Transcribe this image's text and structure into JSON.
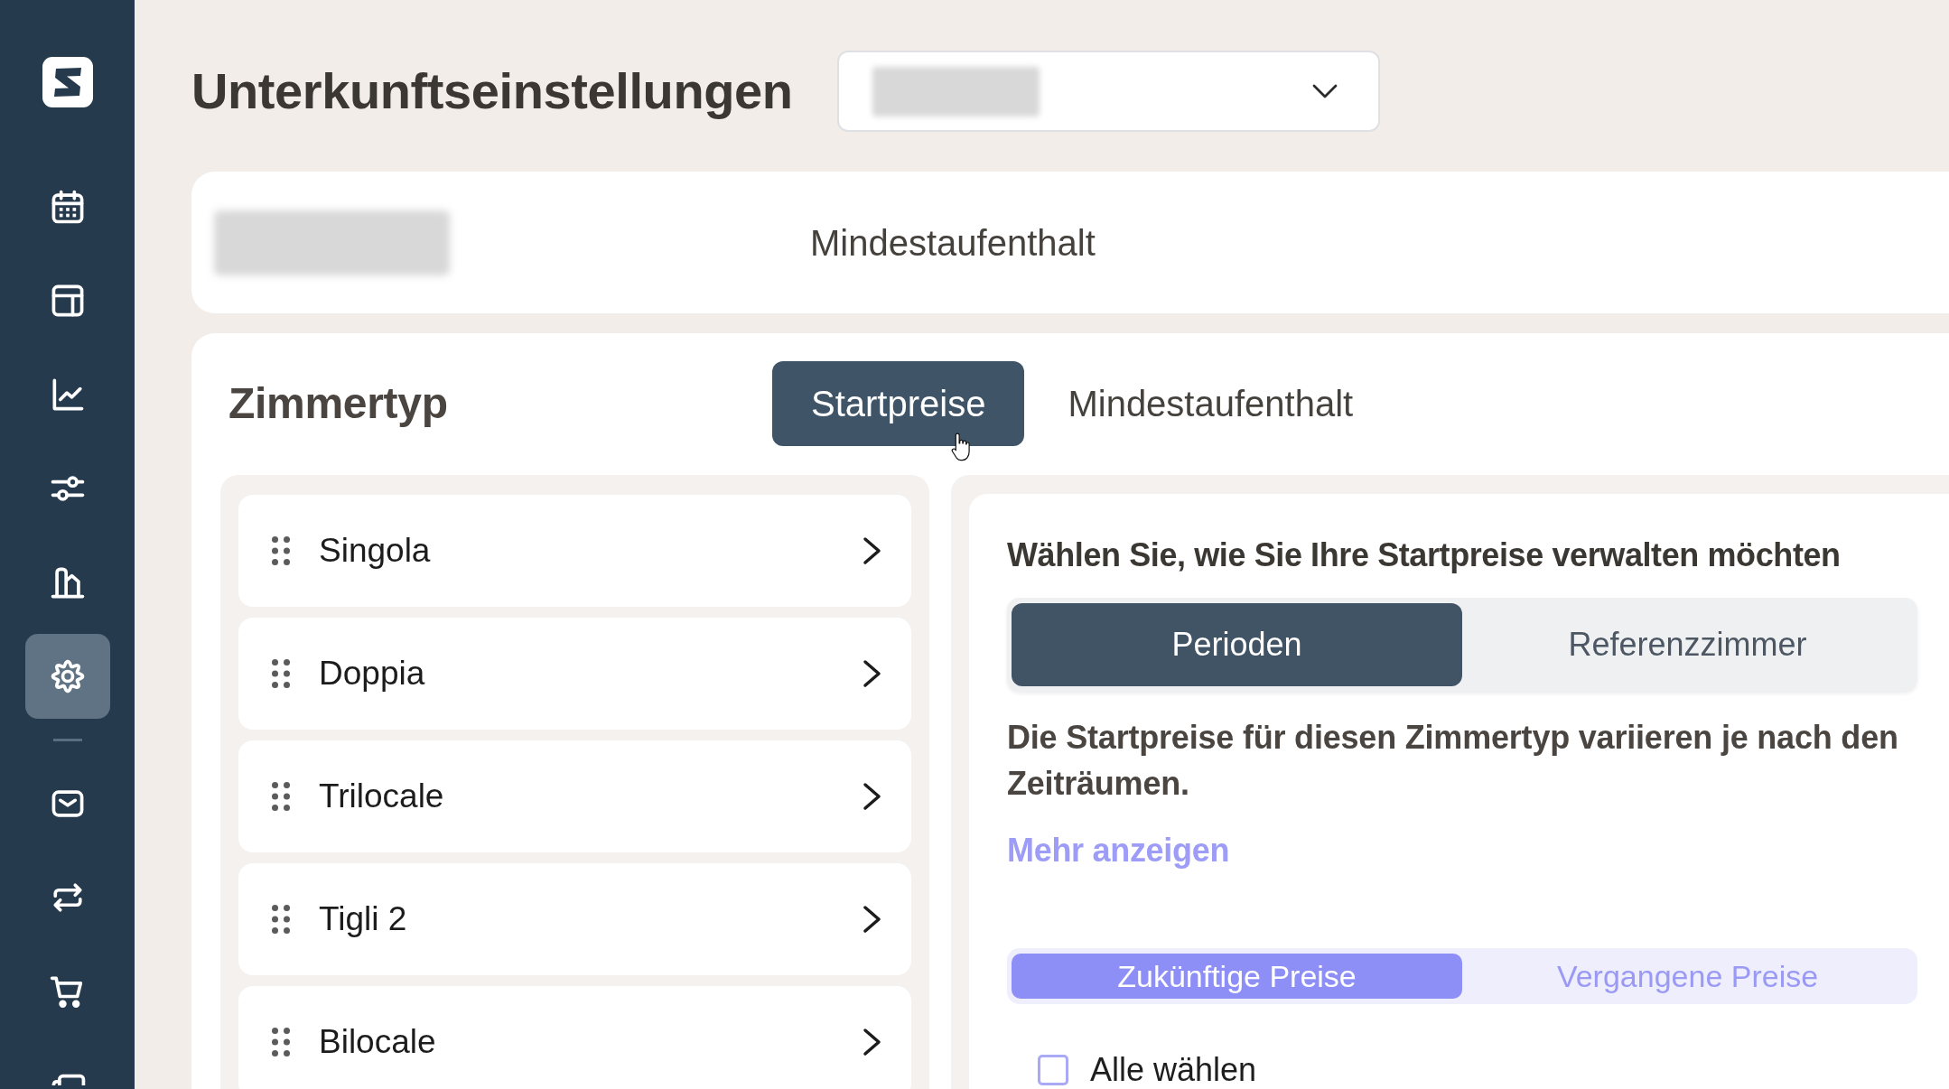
{
  "sidebar": {
    "primary_items": [
      {
        "selected": false
      },
      {
        "selected": false
      },
      {
        "selected": false
      },
      {
        "selected": false
      },
      {
        "selected": false
      },
      {
        "selected": true
      }
    ],
    "secondary_items": [
      {
        "selected": false
      },
      {
        "selected": false
      },
      {
        "selected": false
      },
      {
        "selected": false
      }
    ]
  },
  "header": {
    "title": "Unterkunftseinstellungen",
    "property_select": {
      "value_blurred": true
    }
  },
  "summary_card": {
    "name_blurred": true,
    "column_label": "Mindestaufenthalt"
  },
  "room_types": {
    "title": "Zimmertyp",
    "tabs": [
      {
        "label": "Startpreise",
        "selected": true
      },
      {
        "label": "Mindestaufenthalt",
        "selected": false
      }
    ],
    "rooms": [
      {
        "name": "Singola"
      },
      {
        "name": "Doppia"
      },
      {
        "name": "Trilocale"
      },
      {
        "name": "Tigli 2"
      },
      {
        "name": "Bilocale"
      }
    ]
  },
  "start_prices": {
    "heading": "Wählen Sie, wie Sie Ihre Startpreise verwalten möchten",
    "modes": [
      {
        "label": "Perioden",
        "selected": true
      },
      {
        "label": "Referenzzimmer",
        "selected": false
      }
    ],
    "description": "Die Startpreise für diesen Zimmertyp variieren je nach den Zeiträumen.",
    "link": "Mehr anzeigen",
    "price_tabs": [
      {
        "label": "Zukünftige Preise",
        "selected": true
      },
      {
        "label": "Vergangene Preise",
        "selected": false
      }
    ],
    "select_all": {
      "label": "Alle wählen",
      "checked": false
    }
  }
}
